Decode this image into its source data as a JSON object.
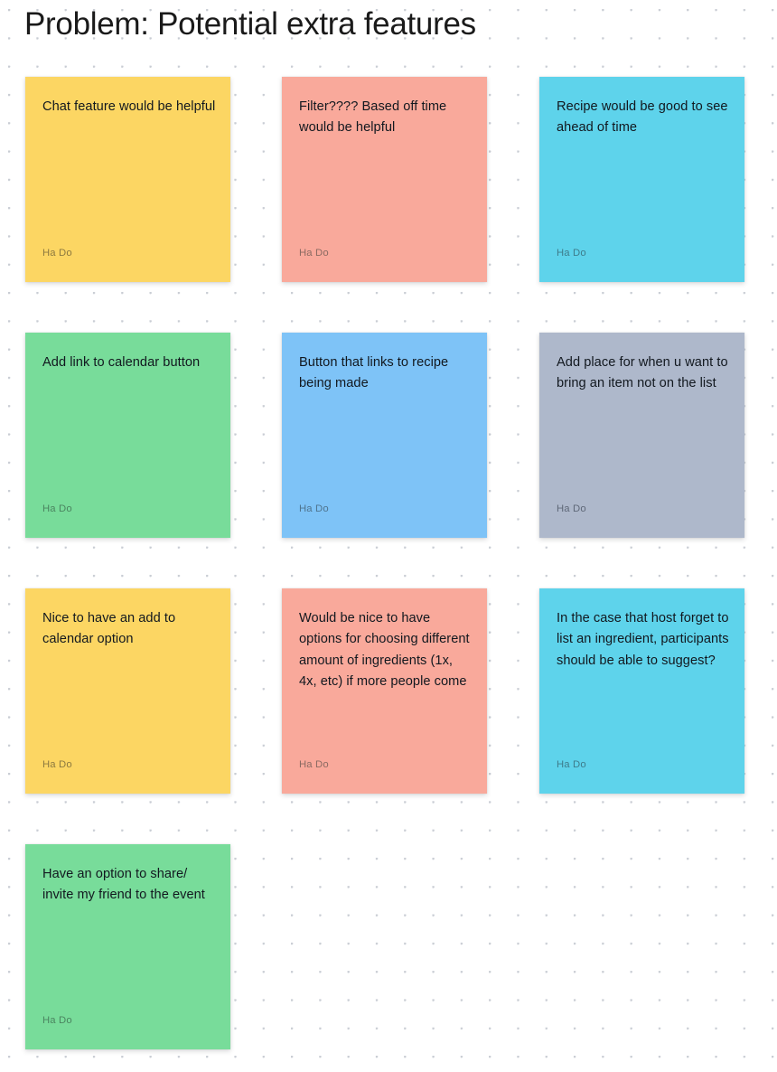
{
  "board": {
    "title": "Problem: Potential extra features",
    "background": "#ffffff",
    "grid_dot_color": "#c9cdd4",
    "text_color": "#12181f"
  },
  "notes": [
    {
      "text": "Chat feature would be helpful",
      "author": "Ha Do",
      "color": "#FCD663",
      "author_color": "#8c7940",
      "column": 1,
      "row": 1
    },
    {
      "text": "Filter???? Based off time would be helpful",
      "author": "Ha Do",
      "color": "#F9A99B",
      "author_color": "#8a6a62",
      "column": 2,
      "row": 1
    },
    {
      "text": "Recipe would be good to see ahead of time",
      "author": "Ha Do",
      "color": "#5ED3EB",
      "author_color": "#3e7c8b",
      "column": 3,
      "row": 1
    },
    {
      "text": "Add link to calendar button",
      "author": "Ha Do",
      "color": "#78DC9A",
      "author_color": "#4b8560",
      "column": 1,
      "row": 2
    },
    {
      "text": "Button that links to recipe being made",
      "author": "Ha Do",
      "color": "#7EC3F7",
      "author_color": "#4f748f",
      "column": 2,
      "row": 2
    },
    {
      "text": "Add place for when u want to bring an item not on the list",
      "author": "Ha Do",
      "color": "#AEB8CB",
      "author_color": "#5f6878",
      "column": 3,
      "row": 2
    },
    {
      "text": "Nice to have an add to calendar option",
      "author": "Ha Do",
      "color": "#FCD663",
      "author_color": "#8c7940",
      "column": 1,
      "row": 3
    },
    {
      "text": "Would be nice to have options for choosing different amount of ingredients (1x, 4x, etc) if more people come",
      "author": "Ha Do",
      "color": "#F9A99B",
      "author_color": "#8a6a62",
      "column": 2,
      "row": 3
    },
    {
      "text": "In the case that host forget to list an ingredient, participants should be able to suggest?",
      "author": "Ha Do",
      "color": "#5ED3EB",
      "author_color": "#3e7c8b",
      "column": 3,
      "row": 3
    },
    {
      "text": "Have an option to share/ invite my friend to the event",
      "author": "Ha Do",
      "color": "#78DC9A",
      "author_color": "#4b8560",
      "column": 1,
      "row": 4
    }
  ]
}
